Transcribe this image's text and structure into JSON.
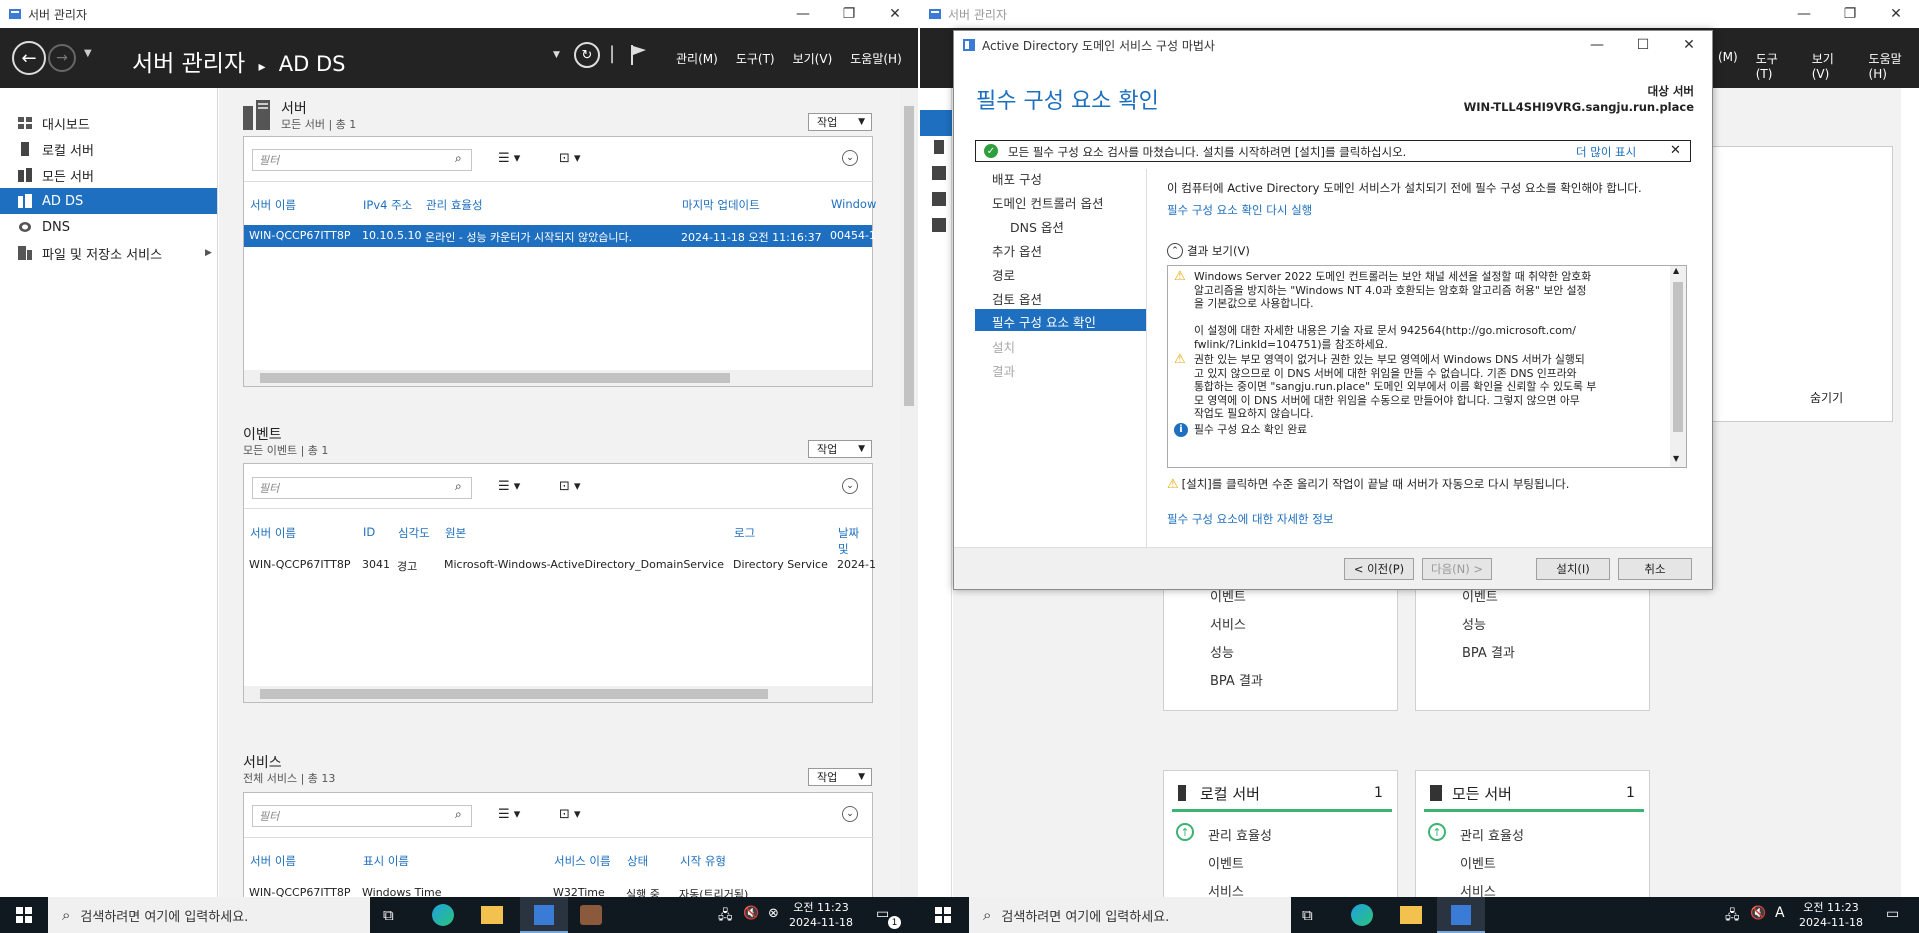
{
  "left": {
    "window_title": "서버 관리자",
    "header_title": "서버 관리자",
    "header_sep": "▸",
    "header_page": "AD DS",
    "menus": [
      "관리(M)",
      "도구(T)",
      "보기(V)",
      "도움말(H)"
    ],
    "sidebar": [
      "대시보드",
      "로컬 서버",
      "모든 서버",
      "AD DS",
      "DNS",
      "파일 및 저장소 서비스"
    ],
    "servers": {
      "title": "서버",
      "sub": "모든 서버 | 총 1",
      "task": "작업",
      "filter_placeholder": "필터",
      "columns": [
        "서버 이름",
        "IPv4 주소",
        "관리 효율성",
        "마지막 업데이트",
        "Window"
      ],
      "row": [
        "WIN-QCCP67ITT8P",
        "10.10.5.10",
        "온라인 - 성능 카운터가 시작되지 않았습니다.",
        "2024-11-18 오전 11:16:37",
        "00454-1"
      ]
    },
    "events": {
      "title": "이벤트",
      "sub": "모든 이벤트 | 총 1",
      "task": "작업",
      "filter_placeholder": "필터",
      "columns": [
        "서버 이름",
        "ID",
        "심각도",
        "원본",
        "로그",
        "날짜 및"
      ],
      "row": [
        "WIN-QCCP67ITT8P",
        "3041",
        "경고",
        "Microsoft-Windows-ActiveDirectory_DomainService",
        "Directory Service",
        "2024-1"
      ]
    },
    "services": {
      "title": "서비스",
      "sub": "전체 서비스 | 총 13",
      "task": "작업",
      "filter_placeholder": "필터",
      "columns": [
        "서버 이름",
        "표시 이름",
        "서비스 이름",
        "상태",
        "시작 유형"
      ],
      "row": [
        "WIN-QCCP67ITT8P",
        "Windows Time",
        "W32Time",
        "실행 중",
        "자동(트리거됨)"
      ]
    }
  },
  "right": {
    "window_title": "서버 관리자",
    "menus": [
      "(M)",
      "도구(T)",
      "보기(V)",
      "도움말(H)"
    ],
    "hide_label": "숨기기",
    "tile_a": [
      "이벤트",
      "서비스",
      "성능",
      "BPA 결과"
    ],
    "tile_b": [
      "이벤트",
      "성능",
      "BPA 결과"
    ],
    "tile_local": {
      "title": "로컬 서버",
      "count": "1",
      "items": [
        "관리 효율성",
        "이벤트",
        "서비스"
      ]
    },
    "tile_all": {
      "title": "모든 서버",
      "count": "1",
      "items": [
        "관리 효율성",
        "이벤트",
        "서비스"
      ]
    }
  },
  "dialog": {
    "title": "Active Directory 도메인 서비스 구성 마법사",
    "heading": "필수 구성 요소 확인",
    "target_label": "대상 서버",
    "target_value": "WIN-TLL4SHI9VRG.sangju.run.place",
    "banner": "모든 필수 구성 요소 검사를 마쳤습니다. 설치를 시작하려면 [설치]를 클릭하십시오.",
    "banner_more": "더 많이 표시",
    "nav": [
      "배포 구성",
      "도메인 컨트롤러 옵션",
      "DNS 옵션",
      "추가 옵션",
      "경로",
      "검토 옵션",
      "필수 구성 요소 확인",
      "설치",
      "결과"
    ],
    "intro": "이 컴퓨터에 Active Directory 도메인 서비스가 설치되기 전에 필수 구성 요소를 확인해야 합니다.",
    "rerun": "필수 구성 요소 확인 다시 실행",
    "results_toggle": "결과 보기(V)",
    "results": [
      {
        "type": "warn",
        "lines": [
          "Windows Server 2022 도메인 컨트롤러는 보안 채널 세션을 설정할 때 취약한 암호화",
          "알고리즘을 방지하는 \"Windows NT 4.0과 호환되는 암호화 알고리즘 허용\" 보안 설정",
          "을 기본값으로 사용합니다.",
          "",
          "이 설정에 대한 자세한 내용은 기술 자료 문서 942564(http://go.microsoft.com/",
          "fwlink/?LinkId=104751)를 참조하세요."
        ]
      },
      {
        "type": "warn",
        "lines": [
          "권한 있는 부모 영역이 없거나 권한 있는 부모 영역에서 Windows DNS 서버가 실행되",
          "고 있지 않으므로 이 DNS 서버에 대한 위임을 만들 수 없습니다. 기존 DNS 인프라와",
          "통합하는 중이면 \"sangju.run.place\" 도메인 외부에서 이름 확인을 신뢰할 수 있도록 부",
          "모 영역에 이 DNS 서버에 대한 위임을 수동으로 만들어야 합니다. 그렇지 않으면 아무",
          "작업도 필요하지 않습니다."
        ]
      },
      {
        "type": "info",
        "lines": [
          "필수 구성 요소 확인 완료"
        ]
      }
    ],
    "reboot_note": "[설치]를 클릭하면 수준 올리기 작업이 끝날 때 서버가 자동으로 다시 부팅됩니다.",
    "more_info": "필수 구성 요소에 대한 자세한 정보",
    "buttons": {
      "prev": "< 이전(P)",
      "next": "다음(N) >",
      "install": "설치(I)",
      "cancel": "취소"
    }
  },
  "taskbar": {
    "search_placeholder": "검색하려면 여기에 입력하세요.",
    "time": "오전 11:23",
    "date": "2024-11-18",
    "ime": "A",
    "notif": "1"
  }
}
